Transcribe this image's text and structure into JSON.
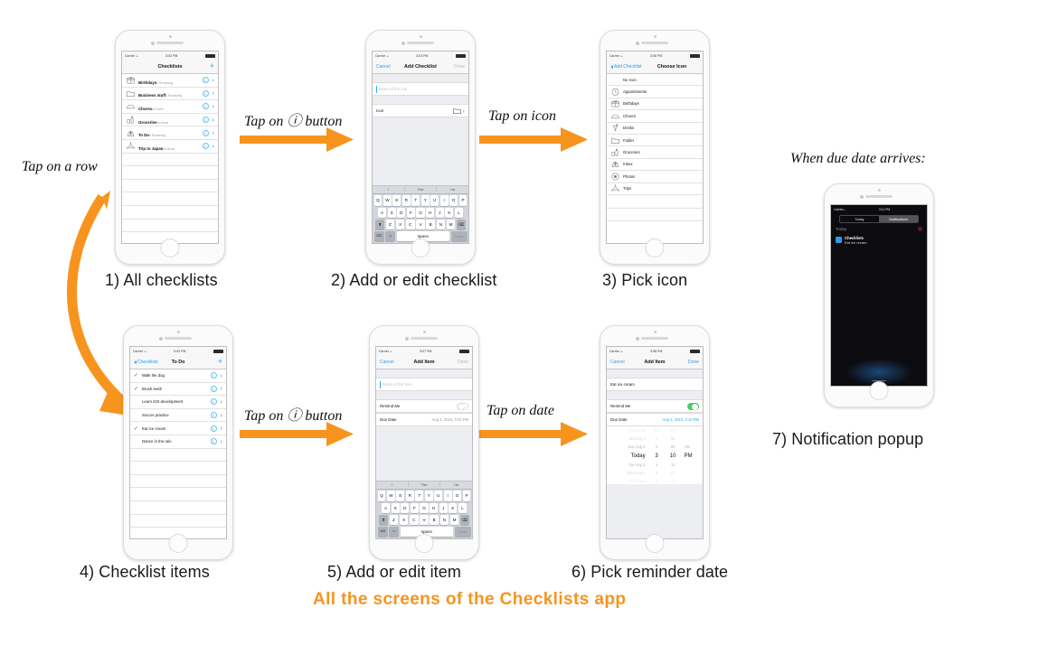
{
  "diagram": {
    "title": "All the screens of the Checklists app",
    "accent_orange": "#f7941e",
    "ios_blue": "#35a8ef",
    "labels": {
      "tap_row": "Tap on a row",
      "tap_info_1": "Tap on ⓘ button",
      "tap_icon": "Tap on icon",
      "tap_info_2": "Tap on ⓘ button",
      "tap_date": "Tap on date",
      "when_due": "When due date arrives:"
    },
    "captions": {
      "c1": "1) All checklists",
      "c2": "2) Add or edit checklist",
      "c3": "3) Pick icon",
      "c4": "4) Checklist items",
      "c5": "5) Add or edit item",
      "c6": "6) Pick reminder date",
      "c7": "7) Notification popup"
    }
  },
  "statusbar": {
    "carrier": "Carrier",
    "time_302": "3:02 PM",
    "time_303": "3:03 PM",
    "time_307": "3:07 PM",
    "time_308": "3:08 PM",
    "time_311": "3:11 PM"
  },
  "screen1": {
    "nav": {
      "title": "Checklists",
      "add": "+"
    },
    "rows": [
      {
        "icon": "birthdays-icon",
        "title": "Birthdays",
        "subtitle": "2 Remaining"
      },
      {
        "icon": "folder-icon",
        "title": "Business stuff",
        "subtitle": "5 Remaining"
      },
      {
        "icon": "chores-icon",
        "title": "Chores",
        "subtitle": "All Done!"
      },
      {
        "icon": "groceries-icon",
        "title": "Groceries",
        "subtitle": "No Items"
      },
      {
        "icon": "inbox-icon",
        "title": "To Do",
        "subtitle": "3 Remaining"
      },
      {
        "icon": "trips-icon",
        "title": "Trip to Japan",
        "subtitle": "No Items"
      }
    ]
  },
  "screen2": {
    "nav": {
      "cancel": "Cancel",
      "title": "Add Checklist",
      "done": "Done"
    },
    "name_placeholder": "Name of the List",
    "icon_label": "Icon"
  },
  "screen3": {
    "nav": {
      "back": "Add Checklist",
      "title": "Choose Icon"
    },
    "options": [
      {
        "icon": "none",
        "label": "No Icon"
      },
      {
        "icon": "appointments-icon",
        "label": "Appointments"
      },
      {
        "icon": "birthdays-icon",
        "label": "Birthdays"
      },
      {
        "icon": "chores-icon",
        "label": "Chores"
      },
      {
        "icon": "drinks-icon",
        "label": "Drinks"
      },
      {
        "icon": "folder-icon",
        "label": "Folder"
      },
      {
        "icon": "groceries-icon",
        "label": "Groceries"
      },
      {
        "icon": "inbox-icon",
        "label": "Inbox"
      },
      {
        "icon": "photos-icon",
        "label": "Photos"
      },
      {
        "icon": "trips-icon",
        "label": "Trips"
      }
    ]
  },
  "screen4": {
    "nav": {
      "back": "Checklists",
      "title": "To Do",
      "add": "+"
    },
    "items": [
      {
        "text": "Walk the dog",
        "checked": true
      },
      {
        "text": "Brush teeth",
        "checked": true
      },
      {
        "text": "Learn iOS development",
        "checked": false
      },
      {
        "text": "Soccer practice",
        "checked": false
      },
      {
        "text": "Eat ice cream",
        "checked": true
      },
      {
        "text": "Dance in the rain",
        "checked": false
      }
    ]
  },
  "screen5": {
    "nav": {
      "cancel": "Cancel",
      "title": "Add Item",
      "done": "Done"
    },
    "name_placeholder": "Name of the Item",
    "remind_label": "Remind Me",
    "remind_on": false,
    "due_label": "Due Date",
    "due_value": "Aug 3, 2015, 3:02 PM"
  },
  "screen6": {
    "nav": {
      "cancel": "Cancel",
      "title": "Add Item",
      "done": "Done"
    },
    "item_name": "Eat ice cream",
    "remind_label": "Remind Me",
    "remind_on": true,
    "due_label": "Due Date",
    "due_value": "Aug 3, 2015, 3:10 PM",
    "picker_rows": [
      {
        "day": "Fri Jul 31",
        "hour": "12",
        "min": "07",
        "ap": ""
      },
      {
        "day": "Sat Aug 1",
        "hour": "1",
        "min": "08",
        "ap": ""
      },
      {
        "day": "Sun Aug 2",
        "hour": "2",
        "min": "09",
        "ap": "AM"
      },
      {
        "day": "Today",
        "hour": "3",
        "min": "10",
        "ap": "PM"
      },
      {
        "day": "Tue Aug 4",
        "hour": "4",
        "min": "11",
        "ap": ""
      },
      {
        "day": "Wed Aug 5",
        "hour": "5",
        "min": "12",
        "ap": ""
      },
      {
        "day": "Thu Aug 6",
        "hour": "6",
        "min": "13",
        "ap": ""
      }
    ],
    "selected_index": 3
  },
  "screen7": {
    "tabs": {
      "today": "Today",
      "notifications": "Notifications"
    },
    "day_header": "Today",
    "app_name": "Checklists",
    "message": "Eat ice cream"
  },
  "keyboard": {
    "predictions": [
      "I",
      "The",
      "I'm"
    ],
    "row1": [
      "Q",
      "W",
      "E",
      "R",
      "T",
      "Y",
      "U",
      "I",
      "O",
      "P"
    ],
    "row2": [
      "A",
      "S",
      "D",
      "F",
      "G",
      "H",
      "J",
      "K",
      "L"
    ],
    "row3": [
      "Z",
      "X",
      "C",
      "V",
      "B",
      "N",
      "M"
    ],
    "shift": "⬆",
    "backspace": "⌫",
    "numbers": "123",
    "emoji": "☺",
    "space": "space",
    "done": "Done"
  }
}
